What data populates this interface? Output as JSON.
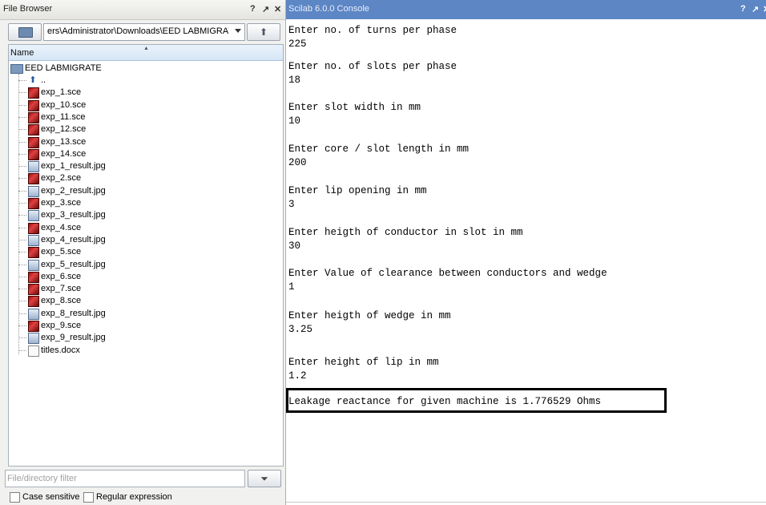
{
  "file_browser": {
    "title": "File Browser",
    "controls": [
      "?",
      "↗",
      "✕"
    ],
    "path": "ers\\Administrator\\Downloads\\EED LABMIGRATE\\",
    "column_header": "Name",
    "root_folder": "EED LABMIGRATE",
    "items": [
      {
        "label": "..",
        "type": "up"
      },
      {
        "label": "exp_1.sce",
        "type": "sce"
      },
      {
        "label": "exp_10.sce",
        "type": "sce"
      },
      {
        "label": "exp_11.sce",
        "type": "sce"
      },
      {
        "label": "exp_12.sce",
        "type": "sce"
      },
      {
        "label": "exp_13.sce",
        "type": "sce"
      },
      {
        "label": "exp_14.sce",
        "type": "sce"
      },
      {
        "label": "exp_1_result.jpg",
        "type": "jpg"
      },
      {
        "label": "exp_2.sce",
        "type": "sce"
      },
      {
        "label": "exp_2_result.jpg",
        "type": "jpg"
      },
      {
        "label": "exp_3.sce",
        "type": "sce"
      },
      {
        "label": "exp_3_result.jpg",
        "type": "jpg"
      },
      {
        "label": "exp_4.sce",
        "type": "sce"
      },
      {
        "label": "exp_4_result.jpg",
        "type": "jpg"
      },
      {
        "label": "exp_5.sce",
        "type": "sce"
      },
      {
        "label": "exp_5_result.jpg",
        "type": "jpg"
      },
      {
        "label": "exp_6.sce",
        "type": "sce"
      },
      {
        "label": "exp_7.sce",
        "type": "sce"
      },
      {
        "label": "exp_8.sce",
        "type": "sce"
      },
      {
        "label": "exp_8_result.jpg",
        "type": "jpg"
      },
      {
        "label": "exp_9.sce",
        "type": "sce"
      },
      {
        "label": "exp_9_result.jpg",
        "type": "jpg"
      },
      {
        "label": "titles.docx",
        "type": "doc"
      }
    ],
    "filter_placeholder": "File/directory filter",
    "case_sensitive_label": "Case sensitive",
    "regex_label": "Regular expression"
  },
  "console": {
    "title": "Scilab 6.0.0 Console",
    "controls": [
      "?",
      "↗",
      "✕"
    ],
    "lines": [
      "Enter no. of turns per phase",
      "225",
      "Enter no. of slots per phase",
      "18",
      "Enter slot width in mm",
      "10",
      "Enter core / slot length in mm",
      "200",
      "Enter lip opening in mm",
      "3",
      "Enter heigth of conductor in slot in mm",
      "30",
      "Enter Value of clearance between conductors and wedge",
      "1",
      "Enter heigth of wedge in mm",
      "3.25",
      "Enter height of lip in mm",
      "1.2"
    ],
    "result": "Leakage reactance for given machine is 1.776529 Ohms"
  }
}
